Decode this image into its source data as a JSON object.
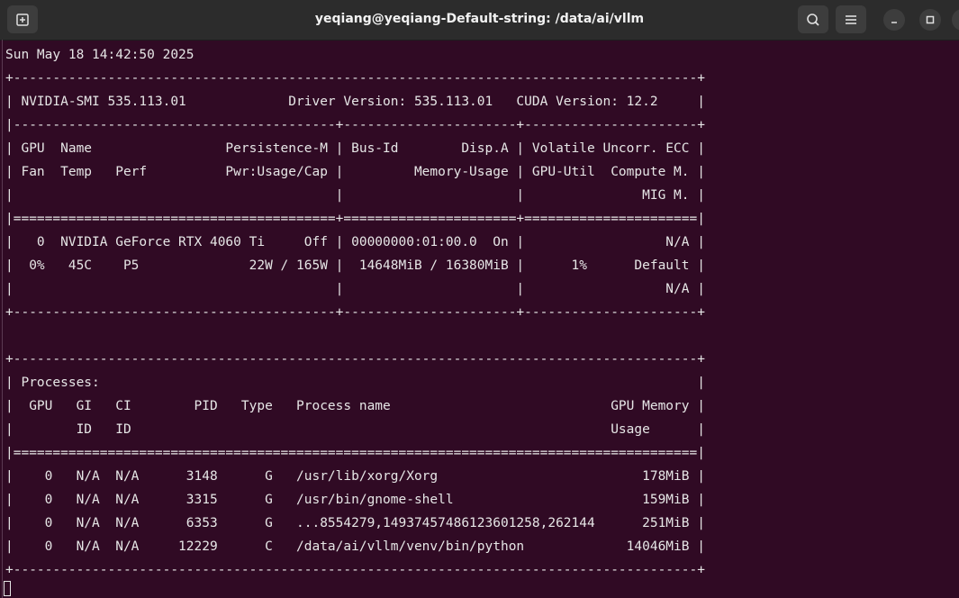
{
  "window": {
    "title": "yeqiang@yeqiang-Default-string: /data/ai/vllm"
  },
  "icons": {
    "new_tab": "new-tab-icon",
    "search": "search-icon",
    "menu": "hamburger-menu-icon",
    "minimize": "minimize-icon",
    "maximize": "maximize-icon",
    "close": "close-icon"
  },
  "terminal": {
    "lines": [
      "Sun May 18 14:42:50 2025",
      "+---------------------------------------------------------------------------------------+",
      "| NVIDIA-SMI 535.113.01             Driver Version: 535.113.01   CUDA Version: 12.2     |",
      "|-----------------------------------------+----------------------+----------------------+",
      "| GPU  Name                 Persistence-M | Bus-Id        Disp.A | Volatile Uncorr. ECC |",
      "| Fan  Temp   Perf          Pwr:Usage/Cap |         Memory-Usage | GPU-Util  Compute M. |",
      "|                                         |                      |               MIG M. |",
      "|=========================================+======================+======================|",
      "|   0  NVIDIA GeForce RTX 4060 Ti     Off | 00000000:01:00.0  On |                  N/A |",
      "|  0%   45C    P5              22W / 165W |  14648MiB / 16380MiB |      1%      Default |",
      "|                                         |                      |                  N/A |",
      "+-----------------------------------------+----------------------+----------------------+",
      "",
      "+---------------------------------------------------------------------------------------+",
      "| Processes:                                                                            |",
      "|  GPU   GI   CI        PID   Type   Process name                            GPU Memory |",
      "|        ID   ID                                                             Usage      |",
      "|=======================================================================================|",
      "|    0   N/A  N/A      3148      G   /usr/lib/xorg/Xorg                          178MiB |",
      "|    0   N/A  N/A      3315      G   /usr/bin/gnome-shell                        159MiB |",
      "|    0   N/A  N/A      6353      G   ...8554279,14937457486123601258,262144      251MiB |",
      "|    0   N/A  N/A     12229      C   /data/ai/vllm/venv/bin/python             14046MiB |",
      "+---------------------------------------------------------------------------------------+"
    ]
  },
  "colors": {
    "terminal_bg": "#300a24",
    "terminal_fg": "#e6e6e6",
    "titlebar_bg": "#2c2c2c"
  }
}
